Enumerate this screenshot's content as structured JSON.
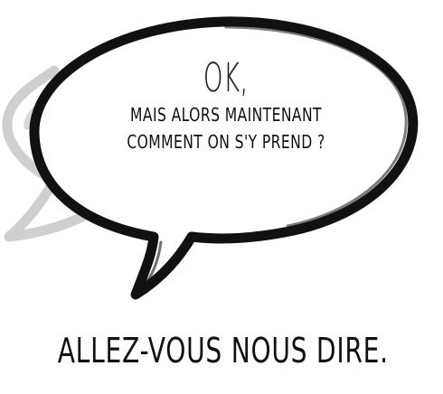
{
  "bubble": {
    "ok_text": "OK,",
    "line1": "MAIS ALORS MAINTENANT",
    "line2": "COMMENT ON S'Y PREND ?"
  },
  "caption": "ALLEZ-VOUS NOUS DIRE.",
  "colors": {
    "ink": "#111111",
    "shadow_bubble": "#c8c8c8",
    "background": "#ffffff"
  }
}
